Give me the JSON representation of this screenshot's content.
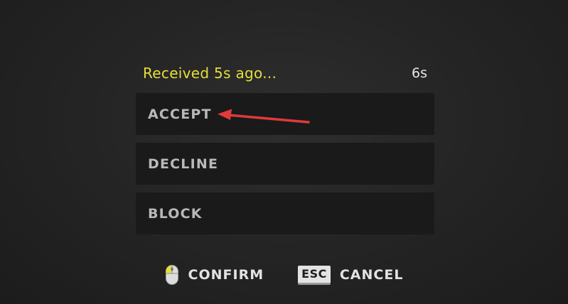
{
  "header": {
    "status": "Received 5s ago...",
    "timer": "6s"
  },
  "options": [
    {
      "label": "ACCEPT"
    },
    {
      "label": "DECLINE"
    },
    {
      "label": "BLOCK"
    }
  ],
  "footer": {
    "confirm_label": "CONFIRM",
    "cancel_key": "ESC",
    "cancel_label": "CANCEL"
  },
  "colors": {
    "status": "#e5df3b",
    "arrow": "#e03a3a",
    "option_bg": "#1a1a1a"
  },
  "icons": {
    "confirm": "mouse-left-click-icon",
    "cancel": "esc-key-icon",
    "annotation": "red-arrow"
  }
}
